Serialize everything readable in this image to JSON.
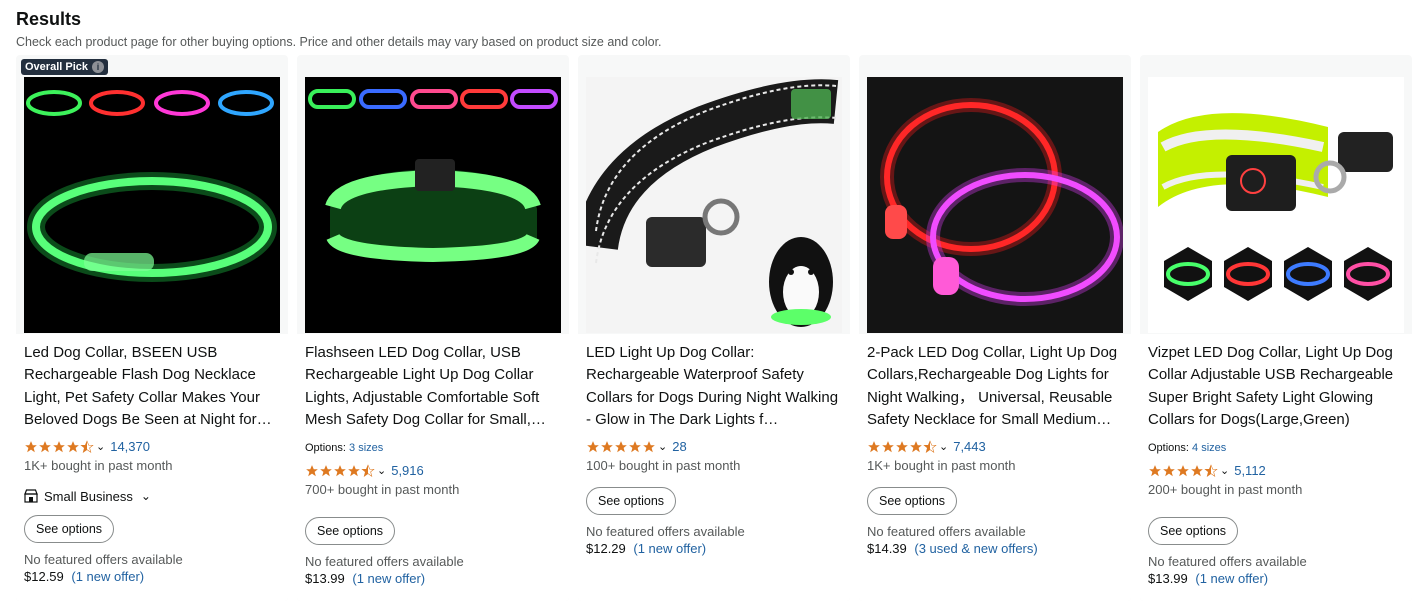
{
  "header": {
    "title": "Results",
    "subtitle": "Check each product page for other buying options. Price and other details may vary based on product size and color."
  },
  "colors": {
    "star": "#de7921",
    "link": "#2162a1",
    "badge": "#232f3e"
  },
  "products": [
    {
      "badge": "Overall Pick",
      "title": "Led Dog Collar, BSEEN USB Rechargeable Flash Dog Necklace Light, Pet Safety Collar Makes Your Beloved Dogs Be Seen at Night for…",
      "rating": 4.5,
      "ratings_count": "14,370",
      "bought": "1K+ bought in past month",
      "business": "Small Business",
      "button": "See options",
      "no_offers": "No featured offers available",
      "price": "$12.59",
      "offers": "(1 new offer)"
    },
    {
      "title": "Flashseen LED Dog Collar, USB Rechargeable Light Up Dog Collar Lights, Adjustable Comfortable Soft Mesh Safety Dog Collar for Small,…",
      "options_label": "Options:",
      "options_link": "3 sizes",
      "rating": 4.5,
      "ratings_count": "5,916",
      "bought": "700+ bought in past month",
      "button": "See options",
      "no_offers": "No featured offers available",
      "price": "$13.99",
      "offers": "(1 new offer)"
    },
    {
      "title": "LED Light Up Dog Collar: Rechargeable Waterproof Safety Collars for Dogs During Night Walking - Glow in The Dark Lights f…",
      "rating": 5,
      "ratings_count": "28",
      "bought": "100+ bought in past month",
      "button": "See options",
      "no_offers": "No featured offers available",
      "price": "$12.29",
      "offers": "(1 new offer)"
    },
    {
      "title": "2-Pack LED Dog Collar, Light Up Dog Collars,Rechargeable Dog Lights for Night Walking， Universal, Reusable Safety Necklace for Small Medium…",
      "rating": 4.5,
      "ratings_count": "7,443",
      "bought": "1K+ bought in past month",
      "button": "See options",
      "no_offers": "No featured offers available",
      "price": "$14.39",
      "offers": "(3 used & new offers)"
    },
    {
      "title": "Vizpet LED Dog Collar, Light Up Dog Collar Adjustable USB Rechargeable Super Bright Safety Light Glowing Collars for Dogs(Large,Green)",
      "options_label": "Options:",
      "options_link": "4 sizes",
      "rating": 4.5,
      "ratings_count": "5,112",
      "bought": "200+ bought in past month",
      "button": "See options",
      "no_offers": "No featured offers available",
      "price": "$13.99",
      "offers": "(1 new offer)"
    }
  ]
}
